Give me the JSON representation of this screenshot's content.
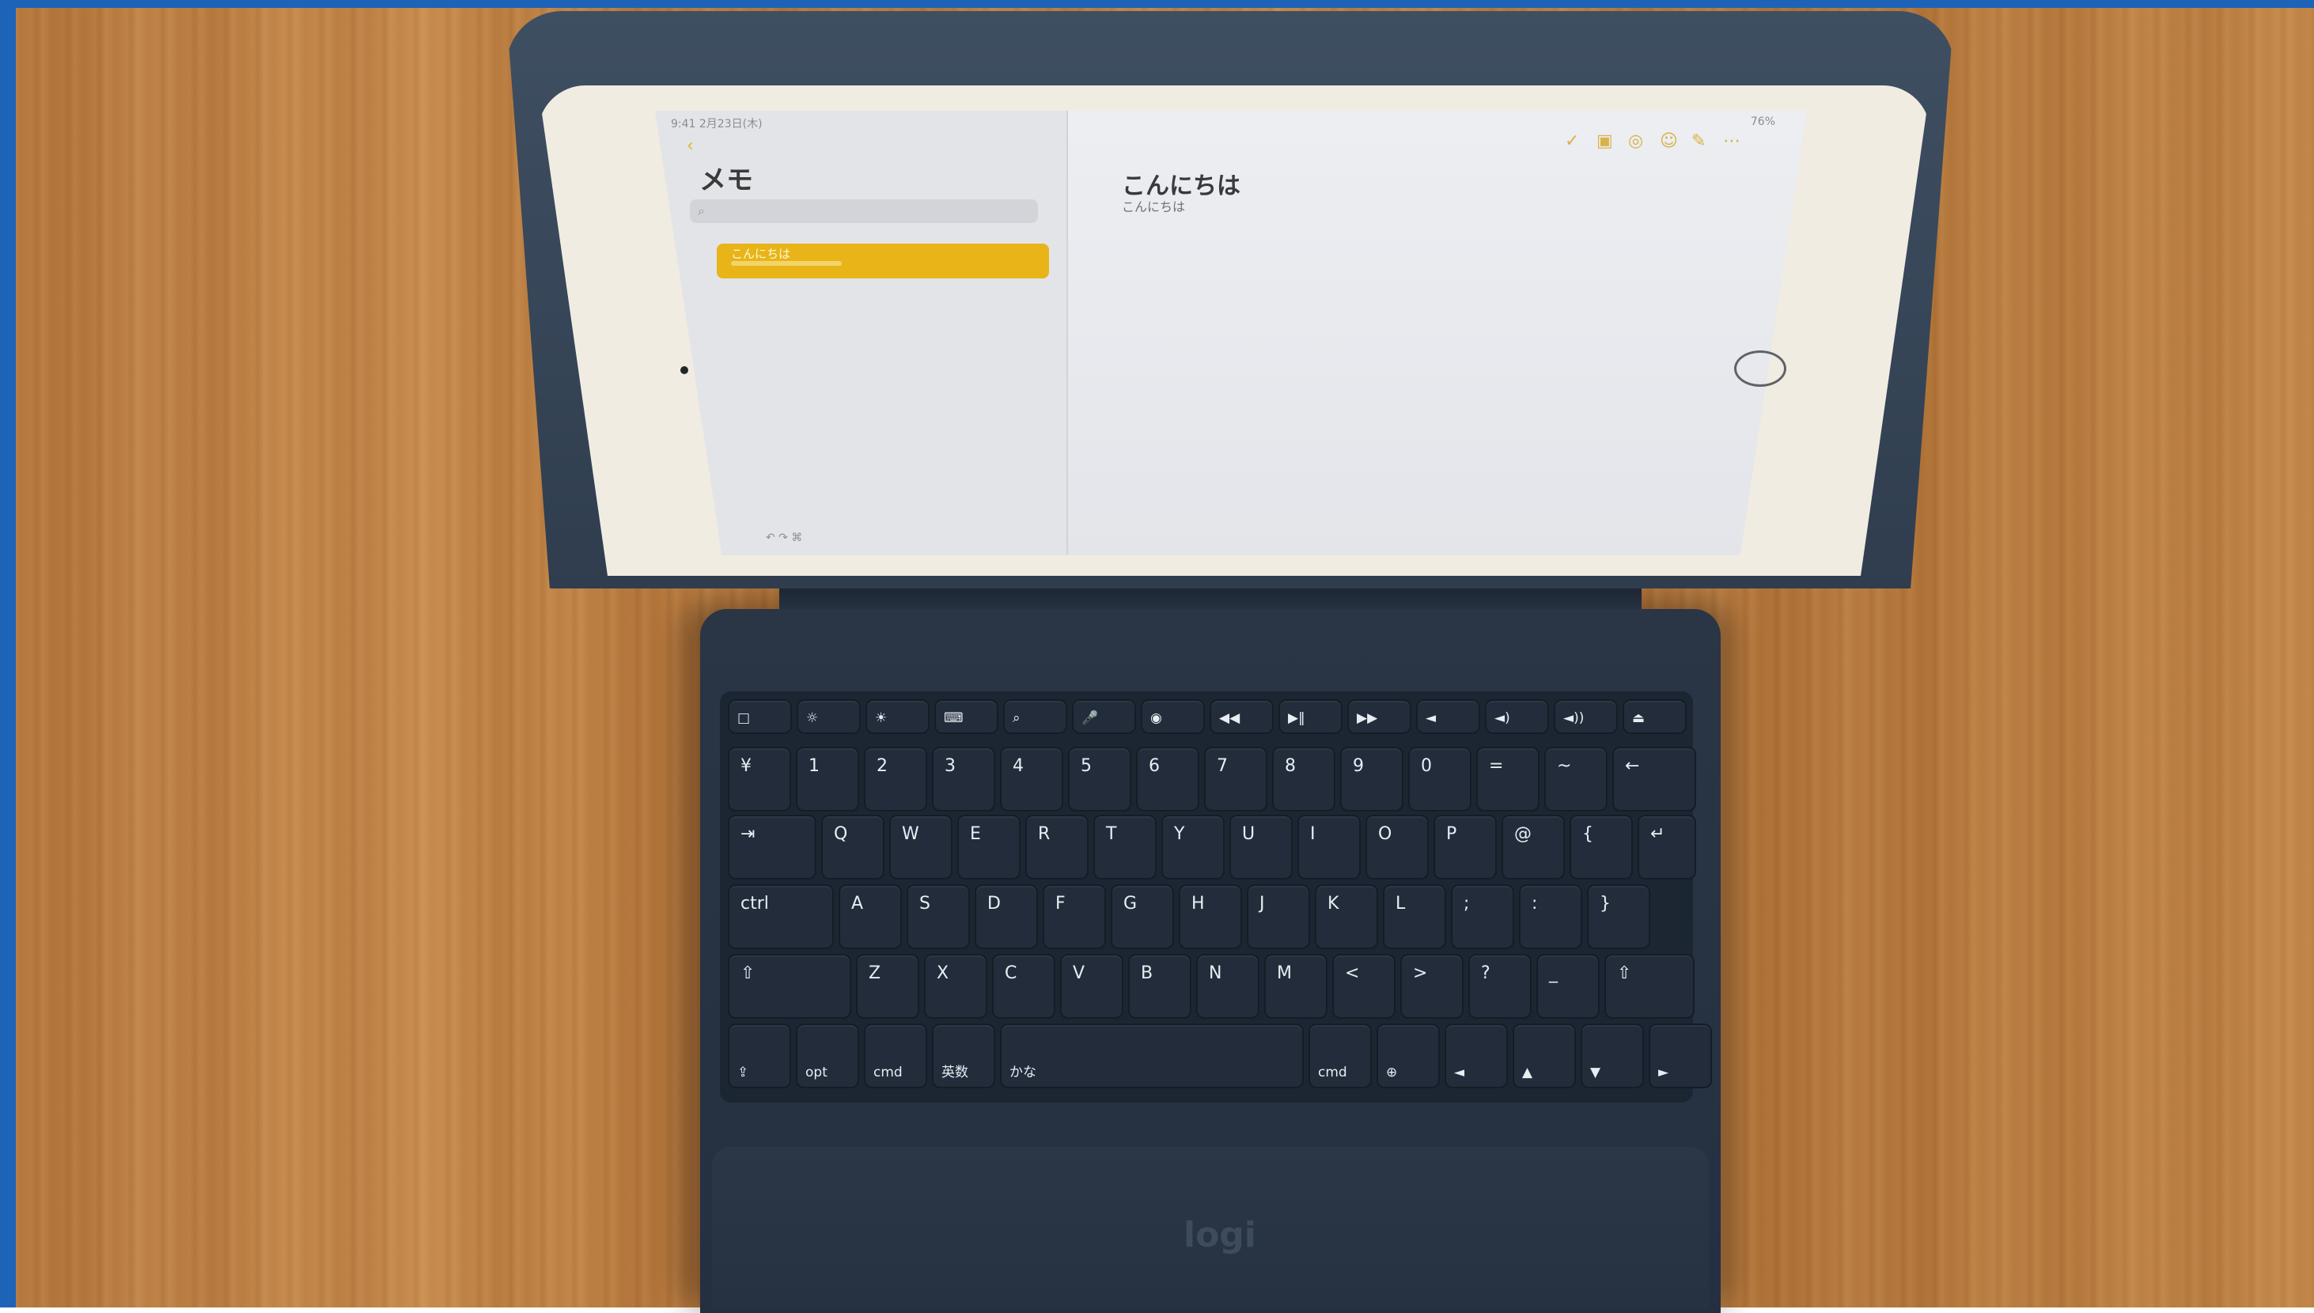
{
  "screen": {
    "status": "9:41 2月23日(木)",
    "battery": "76%",
    "back": "‹",
    "sidebar_title": "メモ",
    "search_icon": "⌕",
    "note_item_title": "こんにちは",
    "note_title": "こんにちは",
    "note_body": "こんにちは",
    "toolbar_icons": [
      "✓",
      "▣",
      "◎",
      "☺",
      "✎",
      "⋯"
    ],
    "bottom_text": "↶ ↷ ⌘"
  },
  "keyboard": {
    "fn_row": [
      "□",
      "☼",
      "☀",
      "⌨",
      "⌕",
      "🎤",
      "◉",
      "◀◀",
      "▶‖",
      "▶▶",
      "◄",
      "◄)",
      "◄))",
      "⏏"
    ],
    "num_row": [
      "¥",
      "1",
      "2",
      "3",
      "4",
      "5",
      "6",
      "7",
      "8",
      "9",
      "0",
      "=",
      "~",
      "←"
    ],
    "q_row": [
      "⇥",
      "Q",
      "W",
      "E",
      "R",
      "T",
      "Y",
      "U",
      "I",
      "O",
      "P",
      "@",
      "{",
      "↵"
    ],
    "a_row": [
      "ctrl",
      "A",
      "S",
      "D",
      "F",
      "G",
      "H",
      "J",
      "K",
      "L",
      ";",
      ":",
      "}"
    ],
    "z_row": [
      "⇧",
      "Z",
      "X",
      "C",
      "V",
      "B",
      "N",
      "M",
      "<",
      ">",
      "?",
      "_",
      "⇧"
    ],
    "bottom_row": [
      "⇪",
      "opt",
      "cmd",
      "英数",
      "かな",
      "cmd",
      "⊕",
      "◄",
      "▲",
      "▼",
      "►"
    ],
    "logo": "logi"
  }
}
